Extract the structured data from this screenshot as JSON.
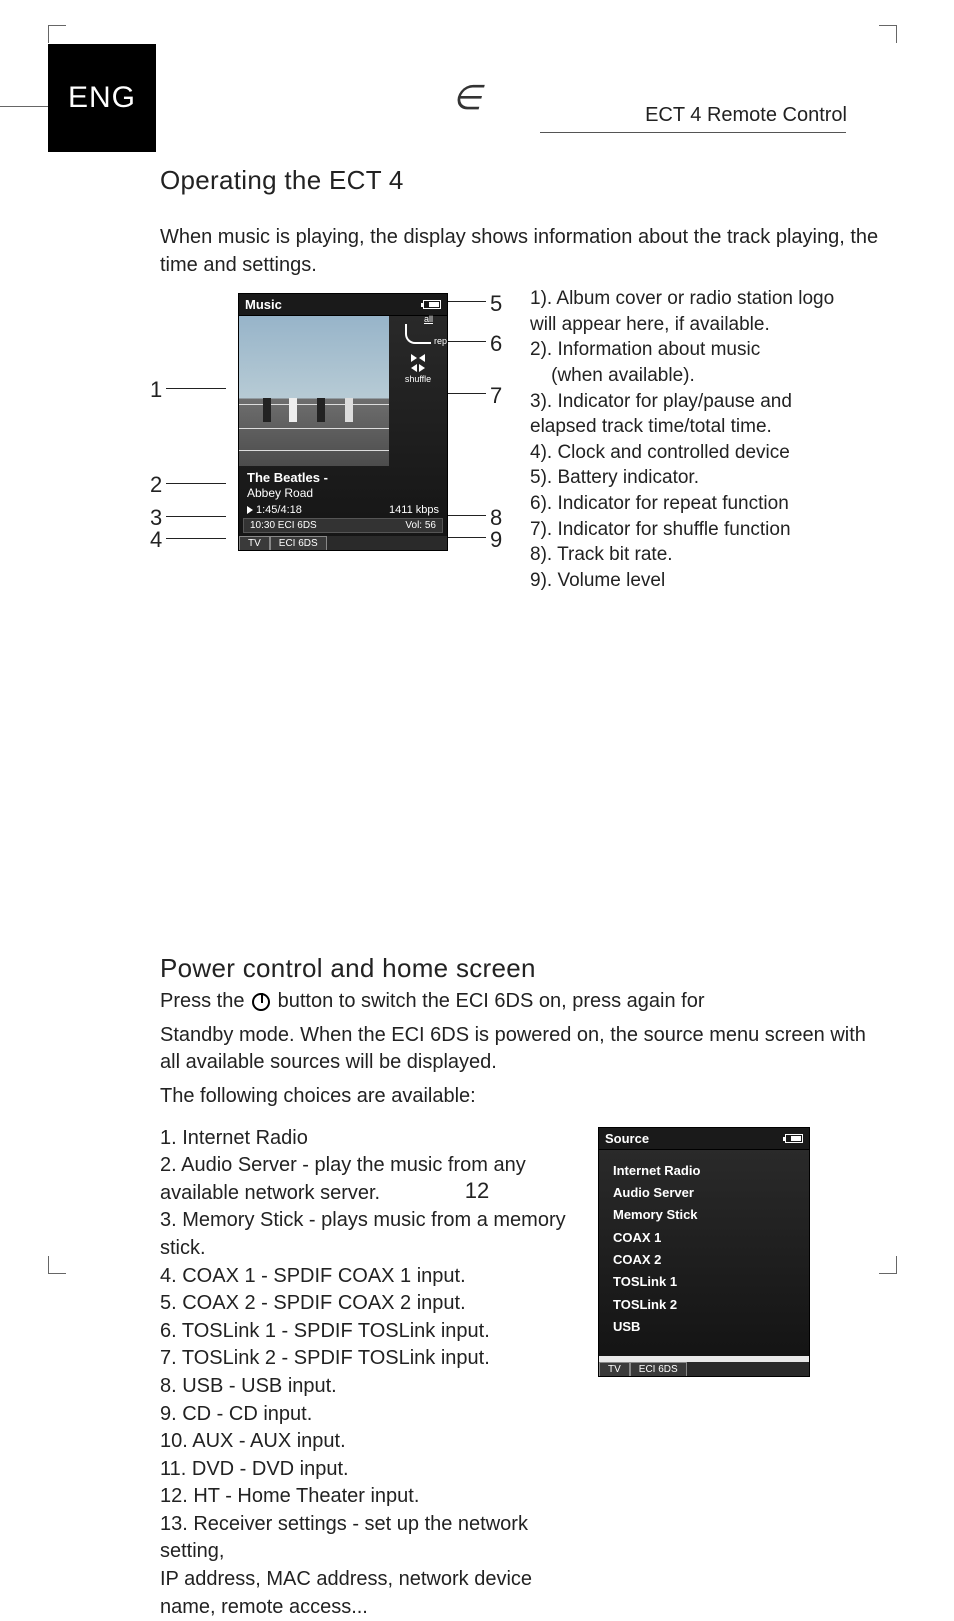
{
  "header": {
    "language_badge": "ENG",
    "doc_title": "ECT 4 Remote Control"
  },
  "section1": {
    "title": "Operating the ECT 4",
    "intro": "When music is playing, the display shows information about the track playing, the time and settings."
  },
  "player": {
    "title": "Music",
    "repeat_all_label": "all",
    "repeat_label": "rep",
    "shuffle_label": "shuffle",
    "artist": "The Beatles -",
    "album": "Abbey Road",
    "time": "1:45/4:18",
    "bitrate": "1411 kbps",
    "clock_line": "10:30 ECI 6DS",
    "volume": "Vol: 56",
    "tab1": "TV",
    "tab2": "ECI 6DS"
  },
  "callouts": {
    "n1": "1",
    "n2": "2",
    "n3": "3",
    "n4": "4",
    "n5": "5",
    "n6": "6",
    "n7": "7",
    "n8": "8",
    "n9": "9"
  },
  "legend": {
    "l1": "1). Album cover or radio station logo will appear here, if available.",
    "l2a": "2). Information about music",
    "l2b": "    (when available).",
    "l3": "3). Indicator for play/pause and elapsed track time/total time.",
    "l4": "4). Clock and controlled device",
    "l5": "5). Battery indicator.",
    "l6": "6). Indicator for repeat function",
    "l7": "7). Indicator for shuffle function",
    "l8": "8). Track bit rate.",
    "l9": "9). Volume level"
  },
  "section2": {
    "title": "Power control and home screen",
    "p1a": "Press the ",
    "p1b": " button to switch the ECI 6DS on, press again for",
    "p2": "Standby mode. When the ECI 6DS is powered on, the source menu screen with all available sources will be displayed.",
    "p3": "The following choices are available:"
  },
  "sources_list": {
    "s1": "1. Internet Radio",
    "s2": "2. Audio Server - play the music from any available network server.",
    "s3": "3. Memory Stick - plays music from a memory stick.",
    "s4": "4. COAX 1 - SPDIF COAX 1 input.",
    "s5": "5. COAX 2 -  SPDIF COAX 2 input.",
    "s6": "6. TOSLink 1 - SPDIF TOSLink input.",
    "s7": "7. TOSLink 2 - SPDIF TOSLink input.",
    "s8": "8. USB - USB input.",
    "s9": "9. CD - CD input.",
    "s10": "10. AUX - AUX input.",
    "s11": "11. DVD - DVD input.",
    "s12": "12. HT - Home Theater input.",
    "s13": "13. Receiver settings - set up the network setting,",
    "s14": "IP address, MAC address, network device name, remote access..."
  },
  "src_screen": {
    "title": "Source",
    "items": [
      "Internet Radio",
      "Audio Server",
      "Memory Stick",
      "COAX 1",
      "COAX 2",
      "TOSLink 1",
      "TOSLink 2",
      "USB"
    ],
    "tab1": "TV",
    "tab2": "ECI 6DS"
  },
  "page_number": "12"
}
